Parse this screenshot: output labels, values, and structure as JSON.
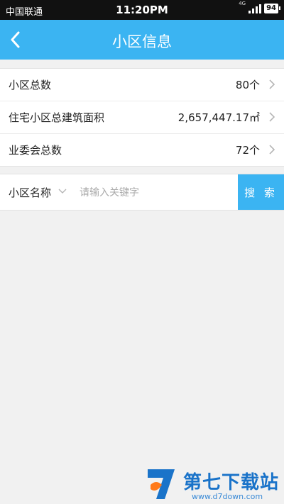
{
  "status_bar": {
    "carrier": "中国联通",
    "time": "11:20PM",
    "network": "4G",
    "battery": "94"
  },
  "header": {
    "title": "小区信息"
  },
  "stats": [
    {
      "label": "小区总数",
      "value": "80个"
    },
    {
      "label": "住宅小区总建筑面积",
      "value": "2,657,447.17㎡"
    },
    {
      "label": "业委会总数",
      "value": "72个"
    }
  ],
  "search": {
    "type_label": "小区名称",
    "placeholder": "请输入关键字",
    "value": "",
    "button_label": "搜 索"
  },
  "watermark": {
    "name": "第七下载站",
    "url": "www.d7down.com"
  },
  "colors": {
    "accent": "#3bb4f2",
    "background": "#f1f1f1"
  }
}
